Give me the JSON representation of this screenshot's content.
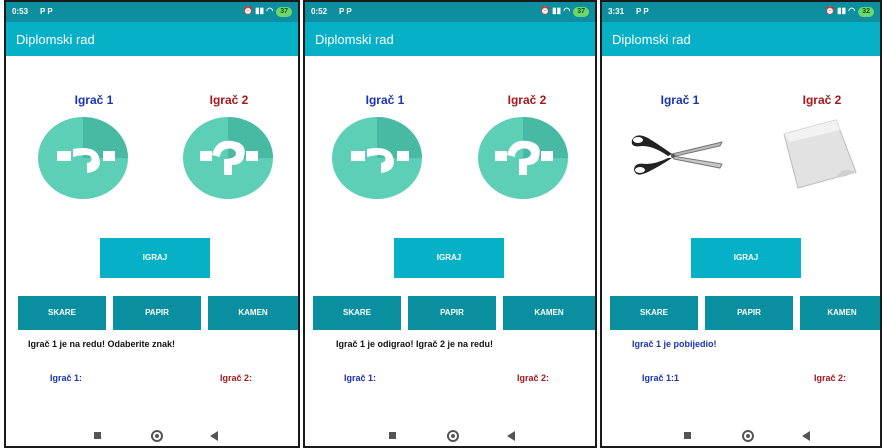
{
  "screens": [
    {
      "status_time": "0:53",
      "status_icons": "P  P",
      "battery": "37",
      "app_title": "Diplomski rad",
      "player1_label": "Igrač 1",
      "player2_label": "Igrač 2",
      "player1_icon": "question-icon",
      "player2_icon": "question-icon",
      "play_button": "IGRAJ",
      "choices": [
        "SKARE",
        "PAPIR",
        "KAMEN"
      ],
      "message": "Igrač 1 je na redu! Odaberite znak!",
      "score1": "Igrač 1:",
      "score2": "Igrač 2:"
    },
    {
      "status_time": "0:52",
      "status_icons": "P  P",
      "battery": "37",
      "app_title": "Diplomski rad",
      "player1_label": "Igrač 1",
      "player2_label": "Igrač 2",
      "player1_icon": "question-icon",
      "player2_icon": "question-icon",
      "play_button": "IGRAJ",
      "choices": [
        "SKARE",
        "PAPIR",
        "KAMEN"
      ],
      "message": "Igrač 1 je odigrao! Igrač 2 je na redu!",
      "score1": "Igrač 1:",
      "score2": "Igrač 2:"
    },
    {
      "status_time": "3:31",
      "status_icons": "P  P",
      "battery": "32",
      "app_title": "Diplomski rad",
      "player1_label": "Igrač 1",
      "player2_label": "Igrač 2",
      "player1_icon": "scissors-icon",
      "player2_icon": "paper-icon",
      "play_button": "IGRAJ",
      "choices": [
        "SKARE",
        "PAPIR",
        "KAMEN"
      ],
      "message": "Igrač 1 je pobijedio!",
      "score1": "Igrač 1:1",
      "score2": "Igrač 2:"
    }
  ],
  "colors": {
    "appbar": "#06b0c6",
    "statusbar": "#0d8fa0",
    "choice_button": "#0a8fa0",
    "player1": "#1a33b4",
    "player2": "#a8161c",
    "emblem": "#5ccfb6"
  }
}
